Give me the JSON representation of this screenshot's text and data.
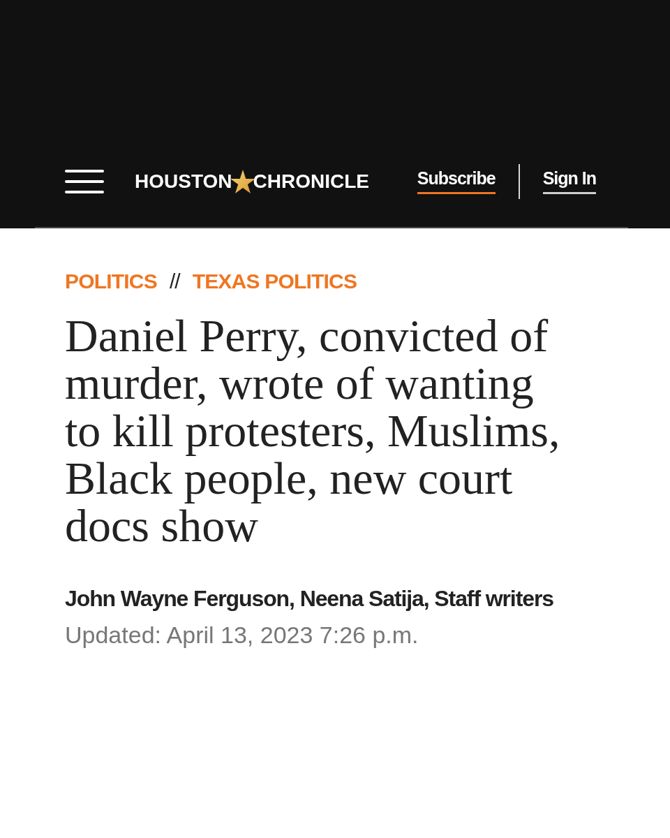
{
  "header": {
    "logo": {
      "left": "HOUSTON",
      "right": "CHRONICLE"
    },
    "links": [
      {
        "label": "Subscribe",
        "kind": "primary"
      },
      {
        "label": "Sign In",
        "kind": "secondary"
      }
    ]
  },
  "breadcrumb": {
    "items": [
      "POLITICS",
      "TEXAS POLITICS"
    ],
    "separator": "//"
  },
  "article": {
    "headline": "Daniel Perry, convicted of murder, wrote of wanting to kill protesters, Muslims, Black people, new court docs show",
    "byline": "John Wayne Ferguson, Neena Satija, Staff writers",
    "updated": "Updated: April 13, 2023 7:26 p.m."
  }
}
